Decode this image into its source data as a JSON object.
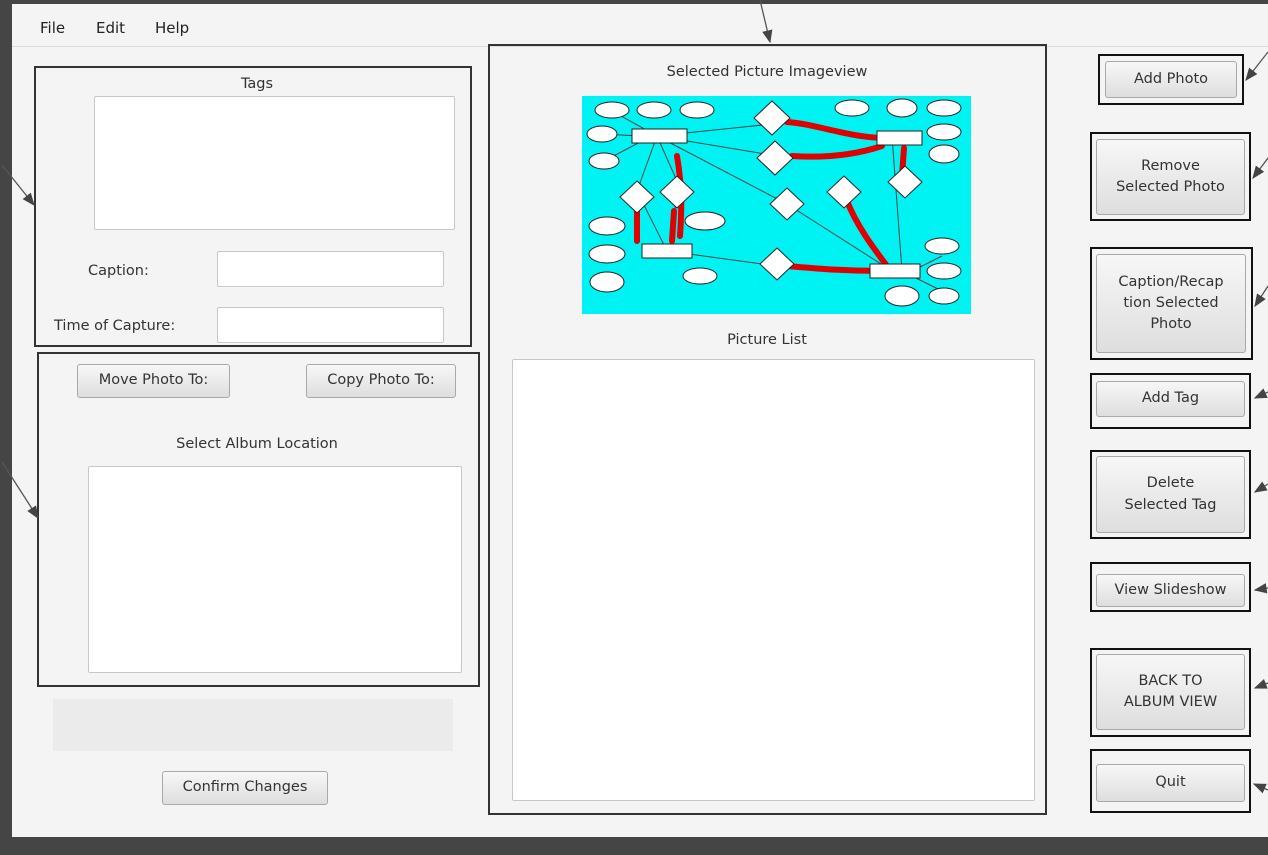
{
  "menu": {
    "file": "File",
    "edit": "Edit",
    "help": "Help"
  },
  "left": {
    "tags_label": "Tags",
    "caption_label": "Caption:",
    "caption_value": "",
    "time_label": "Time of Capture:",
    "time_value": "",
    "move_button": "Move Photo To:",
    "copy_button": "Copy Photo To:",
    "album_label": "Select Album Location",
    "confirm_button": "Confirm Changes"
  },
  "center": {
    "imageview_label": "Selected Picture Imageview",
    "list_label": "Picture List"
  },
  "right": {
    "add_photo": "Add Photo",
    "remove_photo_1": "Remove",
    "remove_photo_2": "Selected Photo",
    "caption_1": "Caption/Recap",
    "caption_2": "tion Selected",
    "caption_3": "Photo",
    "add_tag": "Add Tag",
    "delete_tag_1": "Delete",
    "delete_tag_2": "Selected Tag",
    "slideshow": "View Slideshow",
    "back_1": "BACK TO",
    "back_2": "ALBUM VIEW",
    "quit": "Quit"
  },
  "colors": {
    "frame": "#454545",
    "window": "#f4f4f4",
    "highlight_border": "#111111",
    "image_background": "#00f3f3",
    "diagram_arrow": "#e00000"
  },
  "image": {
    "description_icon": "er-diagram-image"
  }
}
